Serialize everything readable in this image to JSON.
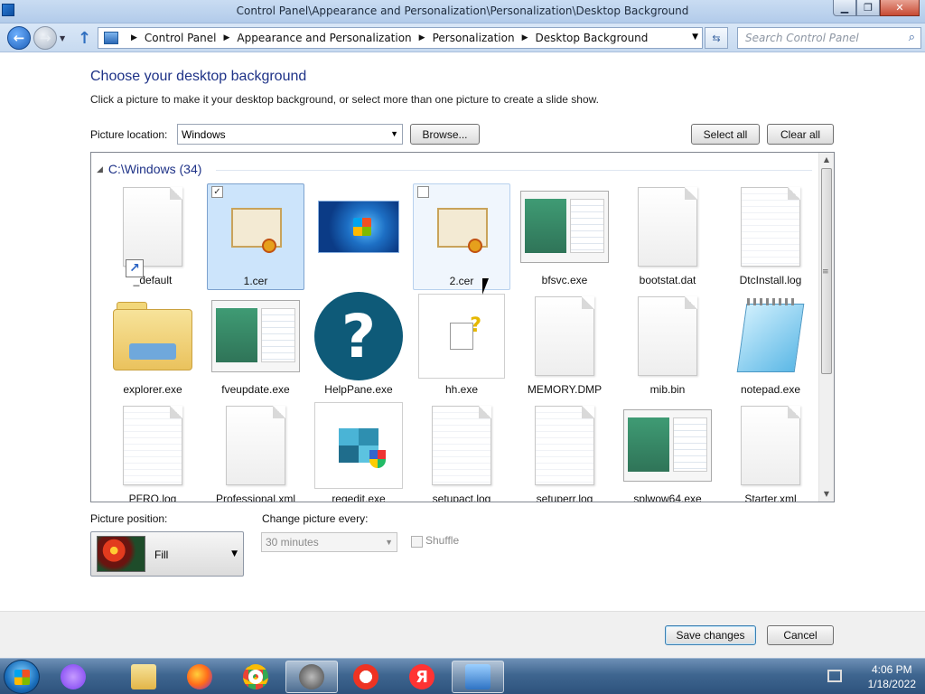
{
  "window": {
    "title": "Control Panel\\Appearance and Personalization\\Personalization\\Desktop Background",
    "minimize": "▁",
    "restore": "❐",
    "close": "✕"
  },
  "nav": {
    "back_glyph": "←",
    "forward_glyph": "→",
    "breadcrumbs": [
      "Control Panel",
      "Appearance and Personalization",
      "Personalization",
      "Desktop Background"
    ],
    "search_placeholder": "Search Control Panel"
  },
  "page": {
    "heading": "Choose your desktop background",
    "subtext": "Click a picture to make it your desktop background, or select more than one picture to create a slide show.",
    "picture_location_label": "Picture location:",
    "picture_location_value": "Windows",
    "browse_label": "Browse...",
    "select_all_label": "Select all",
    "clear_all_label": "Clear all"
  },
  "gallery": {
    "group_title": "C:\\Windows (34)",
    "items": [
      {
        "name": "_default",
        "icon": "file-shortcut-icon",
        "state": "normal"
      },
      {
        "name": "1.cer",
        "icon": "certificate-icon",
        "state": "selected",
        "checked": true
      },
      {
        "name": "",
        "icon": "windows-wallpaper-thumbnail",
        "state": "normal"
      },
      {
        "name": "2.cer",
        "icon": "certificate-icon",
        "state": "hover",
        "checked": false
      },
      {
        "name": "bfsvc.exe",
        "icon": "app-window-icon",
        "state": "normal"
      },
      {
        "name": "bootstat.dat",
        "icon": "blank-file-icon",
        "state": "normal"
      },
      {
        "name": "DtcInstall.log",
        "icon": "text-file-icon",
        "state": "normal"
      },
      {
        "name": "explorer.exe",
        "icon": "folder-icon",
        "state": "normal"
      },
      {
        "name": "fveupdate.exe",
        "icon": "app-window-icon",
        "state": "normal"
      },
      {
        "name": "HelpPane.exe",
        "icon": "help-icon",
        "state": "normal"
      },
      {
        "name": "hh.exe",
        "icon": "help-document-icon",
        "state": "normal"
      },
      {
        "name": "MEMORY.DMP",
        "icon": "blank-file-icon",
        "state": "normal"
      },
      {
        "name": "mib.bin",
        "icon": "blank-file-icon",
        "state": "normal"
      },
      {
        "name": "notepad.exe",
        "icon": "notepad-icon",
        "state": "normal"
      },
      {
        "name": "PFRO.log",
        "icon": "text-file-icon",
        "state": "normal"
      },
      {
        "name": "Professional.xml",
        "icon": "blank-file-icon",
        "state": "normal"
      },
      {
        "name": "regedit.exe",
        "icon": "registry-editor-icon",
        "state": "normal"
      },
      {
        "name": "setupact.log",
        "icon": "text-file-icon",
        "state": "normal"
      },
      {
        "name": "setuperr.log",
        "icon": "text-file-icon",
        "state": "normal"
      },
      {
        "name": "splwow64.exe",
        "icon": "app-window-icon",
        "state": "normal"
      },
      {
        "name": "Starter.xml",
        "icon": "blank-file-icon",
        "state": "normal"
      }
    ]
  },
  "options": {
    "position_label": "Picture position:",
    "position_value": "Fill",
    "change_label": "Change picture every:",
    "change_value": "30 minutes",
    "shuffle_label": "Shuffle"
  },
  "footer": {
    "save_label": "Save changes",
    "cancel_label": "Cancel"
  },
  "taskbar": {
    "apps": [
      "alice-assistant-icon",
      "file-explorer-icon",
      "firefox-icon",
      "chrome-icon",
      "raccoon-app-icon",
      "yandex-browser-icon",
      "yandex-icon",
      "control-panel-icon"
    ],
    "yandex_letter": "Я",
    "time": "4:06 PM",
    "date": "1/18/2022"
  }
}
